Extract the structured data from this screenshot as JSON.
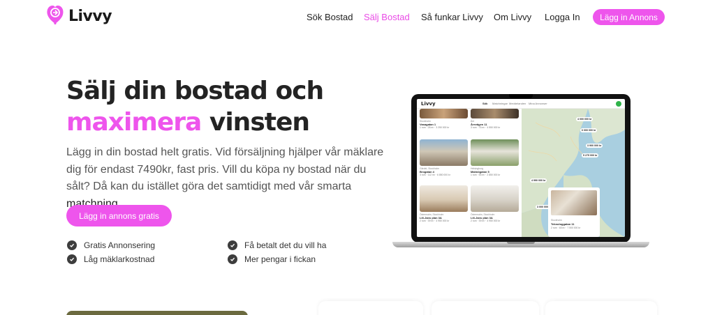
{
  "header": {
    "brand": "Livvy",
    "nav": [
      {
        "label": "Sök Bostad",
        "active": false
      },
      {
        "label": "Sälj Bostad",
        "active": true
      },
      {
        "label": "Så funkar Livvy",
        "active": false
      },
      {
        "label": "Om Livvy",
        "active": false
      },
      {
        "label": "Logga In",
        "active": false
      }
    ],
    "cta_label": "Lägg in Annons"
  },
  "hero": {
    "title_line1": "Sälj din bostad och",
    "title_highlight": "maximera",
    "title_rest": " vinsten",
    "description": "Lägg in din bostad helt gratis. Vid försäljning hjälper vår mäklare dig för endast 7490kr, fast pris. Vill du köpa ny bostad när du sålt? Då kan du istället göra det samtidigt med vår smarta ",
    "description_bold": "matchning",
    "description_end": ".",
    "cta_label": "Lägg in annons gratis",
    "features": [
      "Gratis Annonsering",
      "Få betalt det du vill ha",
      "Låg mäklarkostnad",
      "Mer pengar i fickan"
    ]
  },
  "mockup": {
    "brand": "Livvy",
    "tabs": [
      "Sök",
      "Matchningar",
      "Meddelanden",
      "Mina Annonser"
    ],
    "cards": [
      {
        "location": "Stockholm",
        "title": "Vasagatan 1",
        "meta": "1 rum · 28 m² · 3 250 000 kr"
      },
      {
        "location": "Åre",
        "title": "Årevägen 11",
        "meta": "3 rum · 76 m² · 4 550 000 kr"
      },
      {
        "location": "Gärdet, Stockholm",
        "title": "Brogatan 4",
        "meta": "3 rum · 112 m² · 6 850 000 kr"
      },
      {
        "location": "Helsingborg",
        "title": "Malmögatan 5",
        "meta": "1 rum · 55 m² · 2 850 000 kr"
      },
      {
        "location": "Östermalm, Stockholm",
        "title": "Lill-Jans plan 3A",
        "meta": "2 rum · 39 m² · 4 950 000 kr"
      },
      {
        "location": "Östermalm, Stockholm",
        "title": "Lill-Jans plan 3A",
        "meta": "2 rum · 39 m² · 4 950 000 kr"
      }
    ],
    "map_prices": [
      "4 000 000 kr",
      "6 000 000 kr",
      "3 900 000 kr",
      "5 275 000 kr",
      "4 990 000 kr",
      "3 000 000 kr"
    ],
    "popup": {
      "location": "Stockholm",
      "title": "Teknologgatan 11",
      "meta": "2 rum · 48 m² · 7 500 000 kr"
    }
  },
  "colors": {
    "accent": "#ee55ec",
    "text": "#232323"
  }
}
